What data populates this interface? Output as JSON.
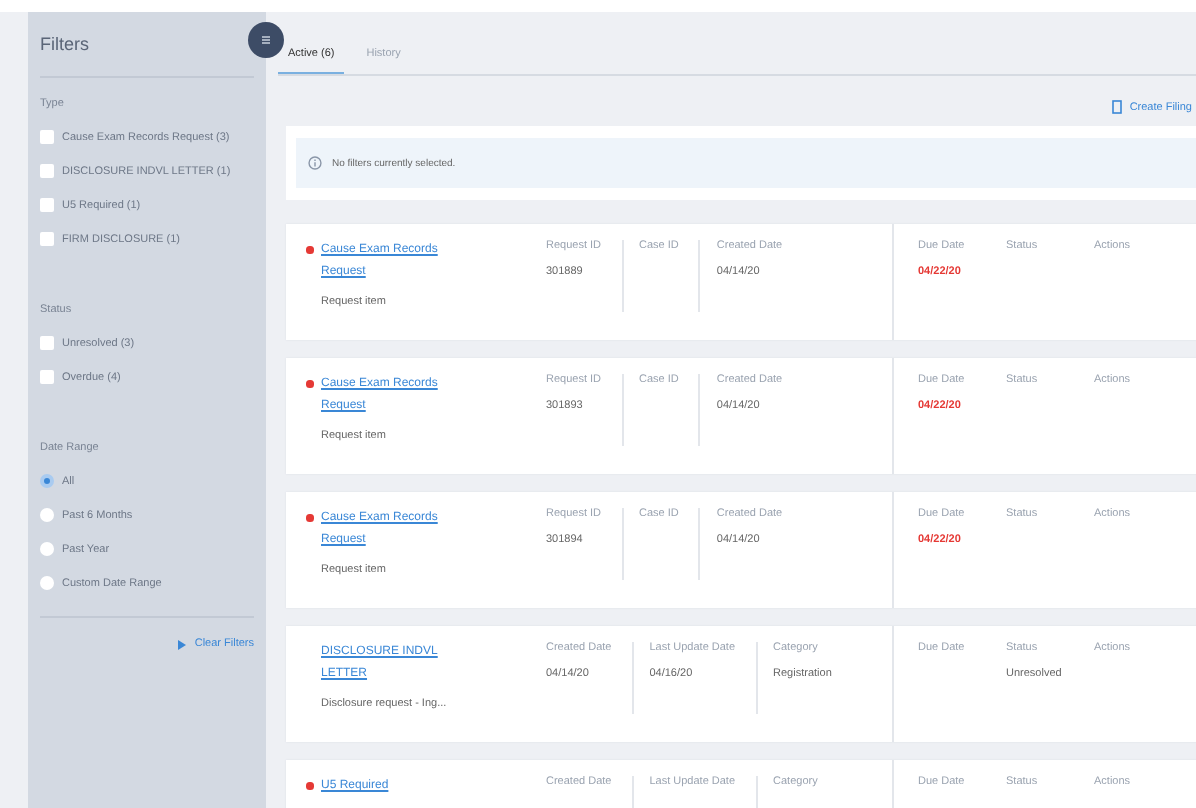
{
  "sidebar": {
    "title": "Filters",
    "sections": [
      {
        "heading": "Type",
        "kind": "checkbox",
        "options": [
          {
            "label": "Cause Exam Records Request (3)",
            "checked": false
          },
          {
            "label": "DISCLOSURE INDVL LETTER (1)",
            "checked": false
          },
          {
            "label": "U5 Required (1)",
            "checked": false
          },
          {
            "label": "FIRM DISCLOSURE (1)",
            "checked": false
          }
        ]
      },
      {
        "heading": "Status",
        "kind": "checkbox",
        "options": [
          {
            "label": "Unresolved (3)",
            "checked": false
          },
          {
            "label": "Overdue (4)",
            "checked": false
          }
        ]
      },
      {
        "heading": "Date Range",
        "kind": "radio",
        "options": [
          {
            "label": "All",
            "selected": true
          },
          {
            "label": "Past 6 Months",
            "selected": false
          },
          {
            "label": "Past Year",
            "selected": false
          },
          {
            "label": "Custom Date Range",
            "selected": false
          }
        ]
      }
    ],
    "clear_link": "Clear Filters"
  },
  "tabs": [
    {
      "label": "Active (6)",
      "selected": true
    },
    {
      "label": "History",
      "selected": false
    }
  ],
  "create_link": "Create Filing",
  "notice": "No filters currently selected.",
  "cards": [
    {
      "flagged": true,
      "title": "Cause Exam Records Request",
      "subtitle": "Request item",
      "fields": [
        {
          "label": "Request ID",
          "value": "301889"
        },
        {
          "label": "Case ID"
        },
        {
          "label": "Created Date",
          "value": "04/14/20"
        }
      ],
      "due": {
        "label": "Due Date",
        "value": "04/22/20",
        "overdue": true
      },
      "status": {
        "label": "Status"
      },
      "actions": "Actions"
    },
    {
      "flagged": true,
      "title": "Cause Exam Records Request",
      "subtitle": "Request item",
      "fields": [
        {
          "label": "Request ID",
          "value": "301893"
        },
        {
          "label": "Case ID"
        },
        {
          "label": "Created Date",
          "value": "04/14/20"
        }
      ],
      "due": {
        "label": "Due Date",
        "value": "04/22/20",
        "overdue": true
      },
      "status": {
        "label": "Status"
      },
      "actions": "Actions"
    },
    {
      "flagged": true,
      "title": "Cause Exam Records Request",
      "subtitle": "Request item",
      "fields": [
        {
          "label": "Request ID",
          "value": "301894"
        },
        {
          "label": "Case ID"
        },
        {
          "label": "Created Date",
          "value": "04/14/20"
        }
      ],
      "due": {
        "label": "Due Date",
        "value": "04/22/20",
        "overdue": true
      },
      "status": {
        "label": "Status"
      },
      "actions": "Actions"
    },
    {
      "flagged": false,
      "title": "DISCLOSURE INDVL LETTER",
      "subtitle": "Disclosure request - Ing...",
      "fields": [
        {
          "label": "Created Date",
          "value": "04/14/20"
        },
        {
          "label": "Last Update Date",
          "value": "04/16/20"
        },
        {
          "label": "Category",
          "value": "Registration"
        }
      ],
      "due": {
        "label": "Due Date"
      },
      "status": {
        "label": "Status",
        "value": "Unresolved"
      },
      "actions": "Actions"
    },
    {
      "flagged": true,
      "title": "U5 Required",
      "fields": [
        {
          "label": "Created Date"
        },
        {
          "label": "Last Update Date"
        },
        {
          "label": "Category"
        }
      ],
      "due": {
        "label": "Due Date"
      },
      "status": {
        "label": "Status"
      },
      "actions": "Actions"
    }
  ]
}
